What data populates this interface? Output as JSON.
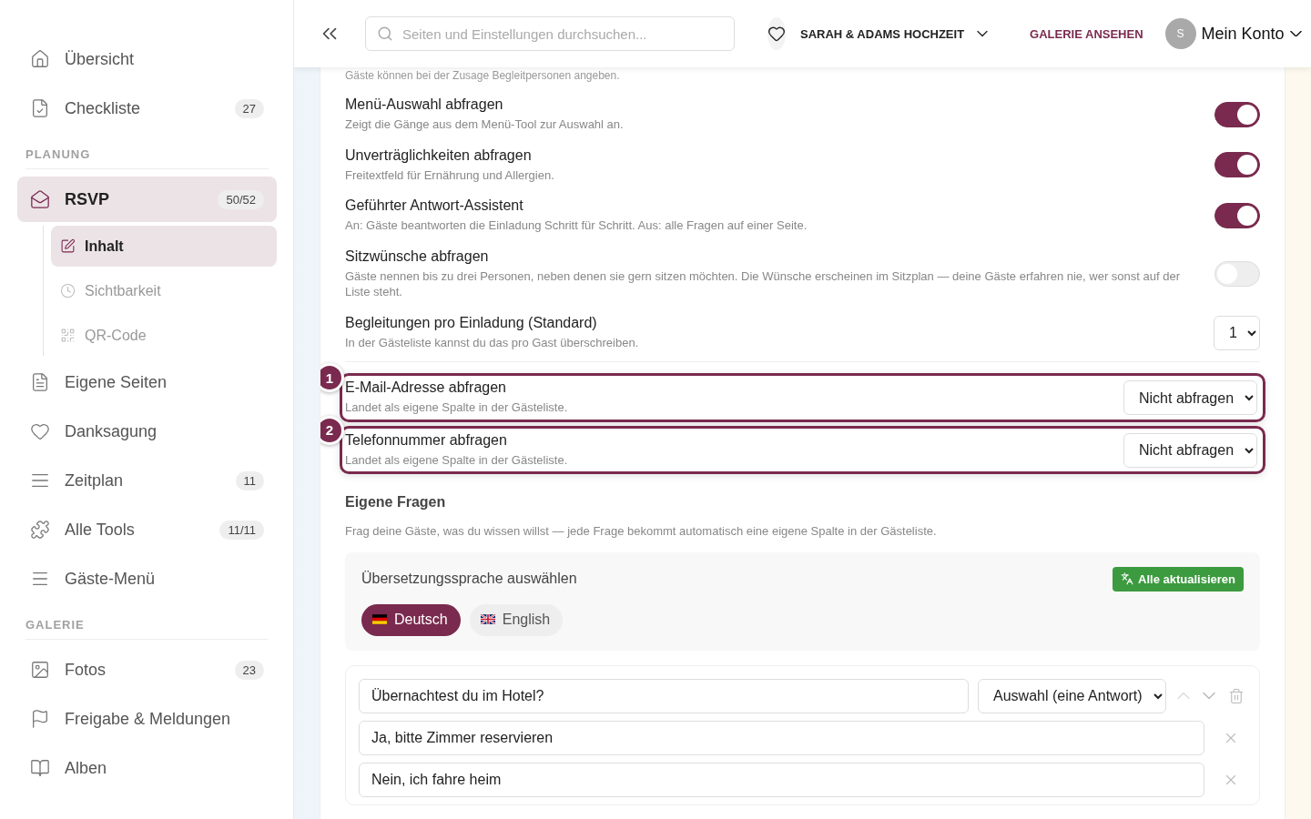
{
  "sidebar": {
    "sections": [
      {
        "items": [
          {
            "label": "Übersicht",
            "selected": false
          },
          {
            "label": "Checkliste",
            "badge": "27",
            "selected": false
          }
        ]
      },
      {
        "heading": "PLANUNG",
        "items": [
          {
            "label": "RSVP",
            "badge": "50/52",
            "selected": true,
            "children": [
              {
                "label": "Inhalt",
                "selected": true
              },
              {
                "label": "Sichtbarkeit",
                "selected": false
              },
              {
                "label": "QR-Code",
                "selected": false
              }
            ]
          },
          {
            "label": "Eigene Seiten",
            "selected": false
          },
          {
            "label": "Danksagung",
            "selected": false
          },
          {
            "label": "Zeitplan",
            "badge": "11",
            "selected": false
          },
          {
            "label": "Alle Tools",
            "badge": "11/11",
            "selected": false
          },
          {
            "label": "Gäste-Menü",
            "selected": false
          }
        ]
      },
      {
        "heading": "GALERIE",
        "items": [
          {
            "label": "Fotos",
            "badge": "23",
            "selected": false
          },
          {
            "label": "Freigabe & Meldungen",
            "selected": false
          },
          {
            "label": "Alben",
            "selected": false
          }
        ]
      }
    ]
  },
  "header": {
    "search": {
      "placeholder": "Seiten und Einstellungen durchsuchen..."
    },
    "event": "SARAH & ADAMS HOCHZEIT",
    "gallery_link": "GALERIE ANSEHEN",
    "avatar": "S",
    "account": "Mein Konto"
  },
  "intro": "Gäste können bei der Zusage Begleitpersonen angeben.",
  "settings": [
    {
      "kind": "toggle",
      "title": "Menü-Auswahl abfragen",
      "description": "Zeigt die Gänge aus dem Menü-Tool zur Auswahl an.",
      "on": true
    },
    {
      "kind": "toggle",
      "title": "Unverträglichkeiten abfragen",
      "description": "Freitextfeld für Ernährung und Allergien.",
      "on": true
    },
    {
      "kind": "toggle",
      "title": "Geführter Antwort-Assistent",
      "description": "An: Gäste beantworten die Einladung Schritt für Schritt. Aus: alle Fragen auf einer Seite.",
      "on": true
    },
    {
      "kind": "toggle",
      "title": "Sitzwünsche abfragen",
      "description": "Gäste nennen bis zu drei Personen, neben denen sie gern sitzen möchten. Die Wünsche erscheinen im Sitzplan — deine Gäste erfahren nie, wer sonst auf der Liste steht.",
      "on": false
    },
    {
      "kind": "select",
      "title": "Begleitungen pro Einladung (Standard)",
      "description": "In der Gästeliste kannst du das pro Gast überschreiben.",
      "value": "1"
    },
    {
      "kind": "select",
      "title": "E-Mail-Adresse abfragen",
      "description": "Landet als eigene Spalte in der Gästeliste.",
      "value": "Nicht abfragen",
      "marker": "1"
    },
    {
      "kind": "select",
      "title": "Telefonnummer abfragen",
      "description": "Landet als eigene Spalte in der Gästeliste.",
      "value": "Nicht abfragen",
      "marker": "2"
    }
  ],
  "custom_questions": {
    "title": "Eigene Fragen",
    "description": "Frag deine Gäste, was du wissen willst — jede Frage bekommt automatisch eine eigene Spalte in der Gästeliste.",
    "translation": {
      "title": "Übersetzungssprache auswählen",
      "button": "Alle aktualisieren",
      "languages": [
        {
          "label": "Deutsch",
          "selected": true
        },
        {
          "label": "English",
          "selected": false
        }
      ]
    },
    "question": {
      "text": "Übernachtest du im Hotel?",
      "type": "Auswahl (eine Antwort)",
      "answers": [
        "Ja, bitte Zimmer reservieren",
        "Nein, ich fahre heim"
      ]
    }
  }
}
